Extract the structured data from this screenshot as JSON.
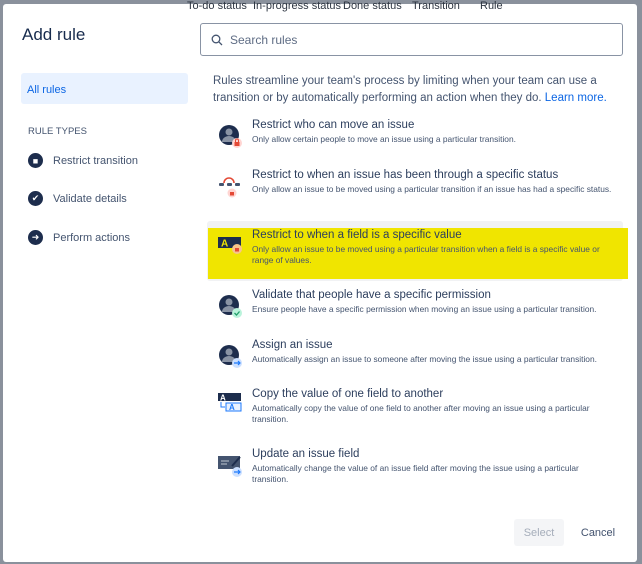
{
  "background_columns": [
    "To-do status",
    "In-progress status",
    "Done status",
    "Transition",
    "Rule"
  ],
  "dialog": {
    "title": "Add rule",
    "search": {
      "placeholder": "Search rules",
      "value": ""
    },
    "sidebar": {
      "all_rules": "All rules",
      "section_label": "RULE TYPES",
      "items": [
        {
          "label": "Restrict transition",
          "icon": "lock-icon"
        },
        {
          "label": "Validate details",
          "icon": "check-icon"
        },
        {
          "label": "Perform actions",
          "icon": "arrow-right-icon"
        }
      ]
    },
    "intro": "Rules streamline your team's process by limiting when your team can use a transition or by automatically performing an action when they do.",
    "learn_more": "Learn more.",
    "rules": [
      {
        "title": "Restrict who can move an issue",
        "desc": "Only allow certain people to move an issue using a particular transition.",
        "icon": "person-lock-icon"
      },
      {
        "title": "Restrict to when an issue has been through a specific status",
        "desc": "Only allow an issue to be moved using a particular transition if an issue has had a specific status.",
        "icon": "status-lock-icon"
      },
      {
        "title": "Restrict to when a field is a specific value",
        "desc": "Only allow an issue to be moved using a particular transition when a field is a specific value or range of values.",
        "icon": "field-lock-icon",
        "highlighted": true
      },
      {
        "title": "Validate that people have a specific permission",
        "desc": "Ensure people have a specific permission when moving an issue using a particular transition.",
        "icon": "person-check-icon"
      },
      {
        "title": "Assign an issue",
        "desc": "Automatically assign an issue to someone after moving the issue using a particular transition.",
        "icon": "person-arrow-icon"
      },
      {
        "title": "Copy the value of one field to another",
        "desc": "Automatically copy the value of one field to another after moving an issue using a particular transition.",
        "icon": "copy-field-icon"
      },
      {
        "title": "Update an issue field",
        "desc": "Automatically change the value of an issue field after moving the issue using a particular transition.",
        "icon": "edit-field-icon"
      }
    ],
    "select_label": "Select",
    "cancel_label": "Cancel",
    "colors": {
      "highlight": "#f0e500",
      "link": "#0c66e4"
    }
  }
}
